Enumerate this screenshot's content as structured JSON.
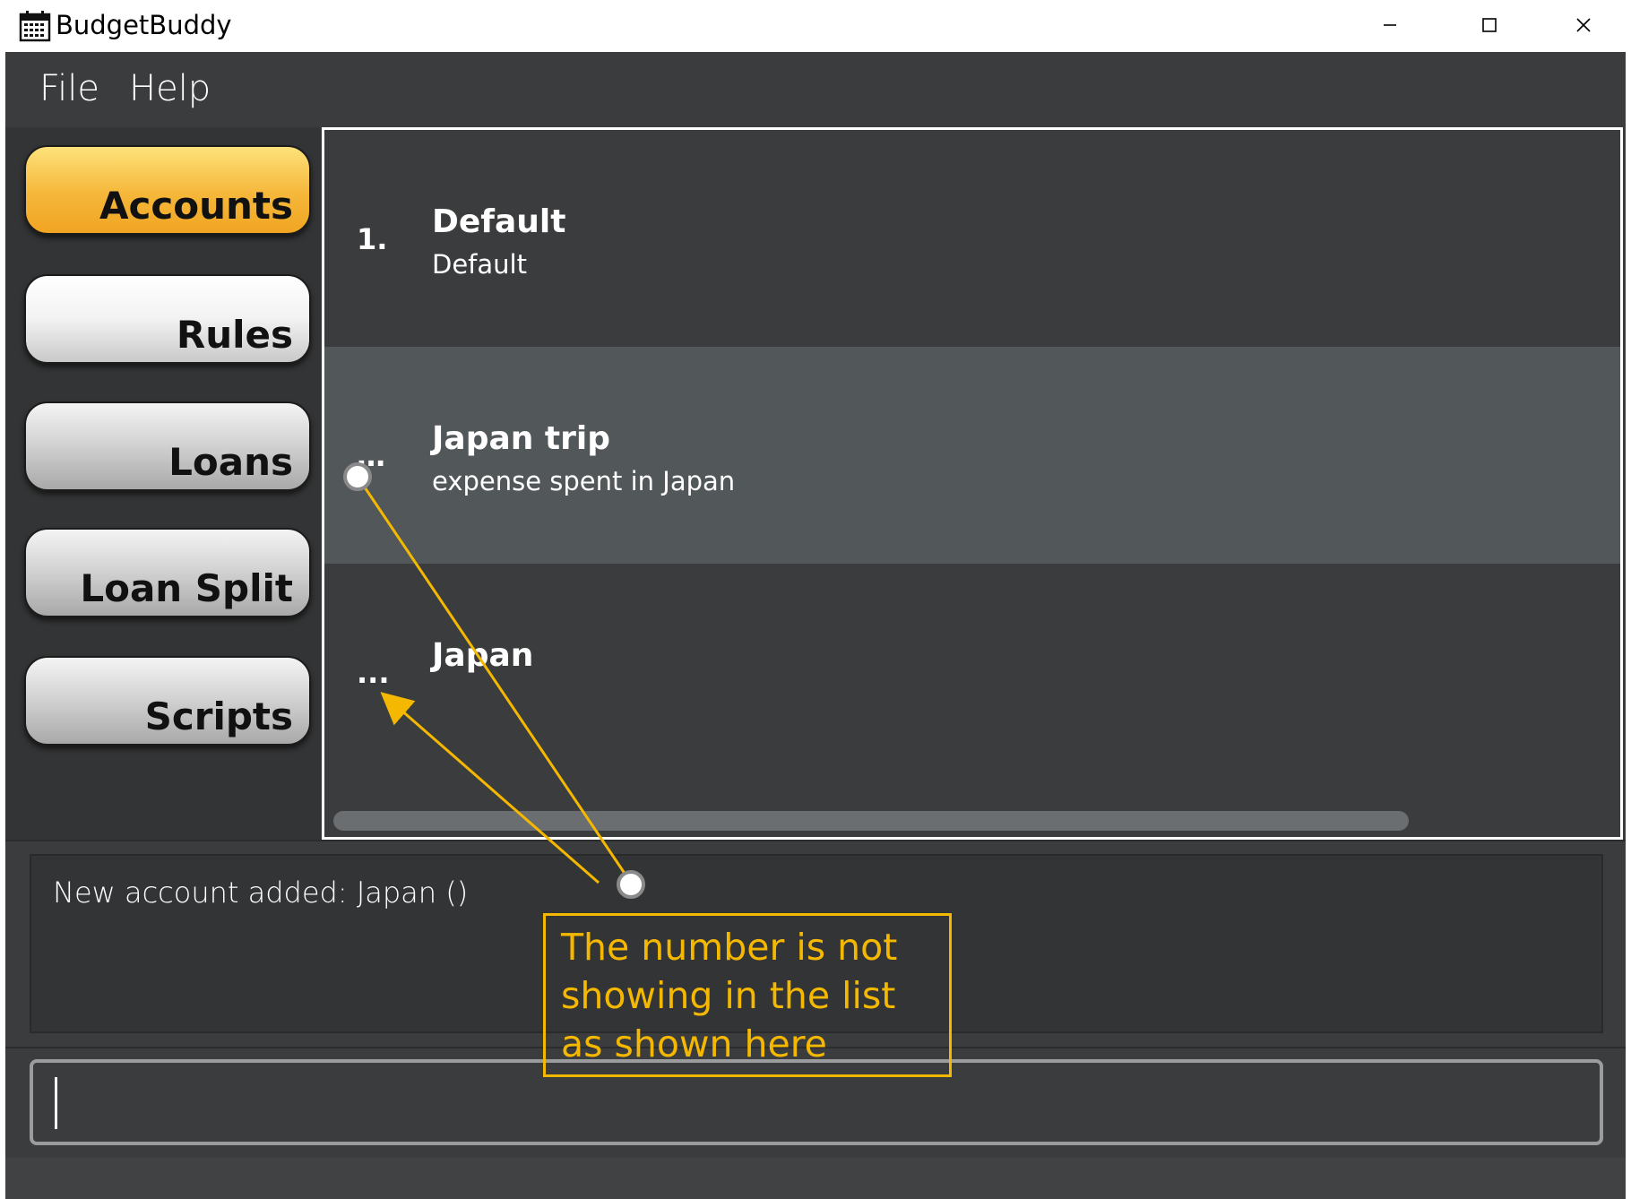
{
  "window": {
    "title": "BudgetBuddy",
    "app_icon": "calendar-icon",
    "controls": [
      "minimize-icon",
      "maximize-icon",
      "close-icon"
    ]
  },
  "menu": {
    "file": "File",
    "help": "Help"
  },
  "sidebar": {
    "items": [
      {
        "label": "Accounts",
        "active": true
      },
      {
        "label": "Rules",
        "active": false
      },
      {
        "label": "Loans",
        "active": false
      },
      {
        "label": "Loan Split",
        "active": false
      },
      {
        "label": "Scripts",
        "active": false
      }
    ]
  },
  "accounts": [
    {
      "index": "1.",
      "name": "Default",
      "description": "Default"
    },
    {
      "index": "…",
      "name": "Japan trip",
      "description": "expense spent in Japan"
    },
    {
      "index": "...",
      "name": "Japan",
      "description": ""
    }
  ],
  "result": {
    "message": "New account added: Japan ()"
  },
  "command": {
    "value": ""
  },
  "annotation": {
    "note": "The number is not showing in the list as shown here",
    "color": "#f5b800"
  },
  "colors": {
    "accent": "#f5b73a",
    "background": "#3b3c3d",
    "selected_row": "#52575a"
  }
}
